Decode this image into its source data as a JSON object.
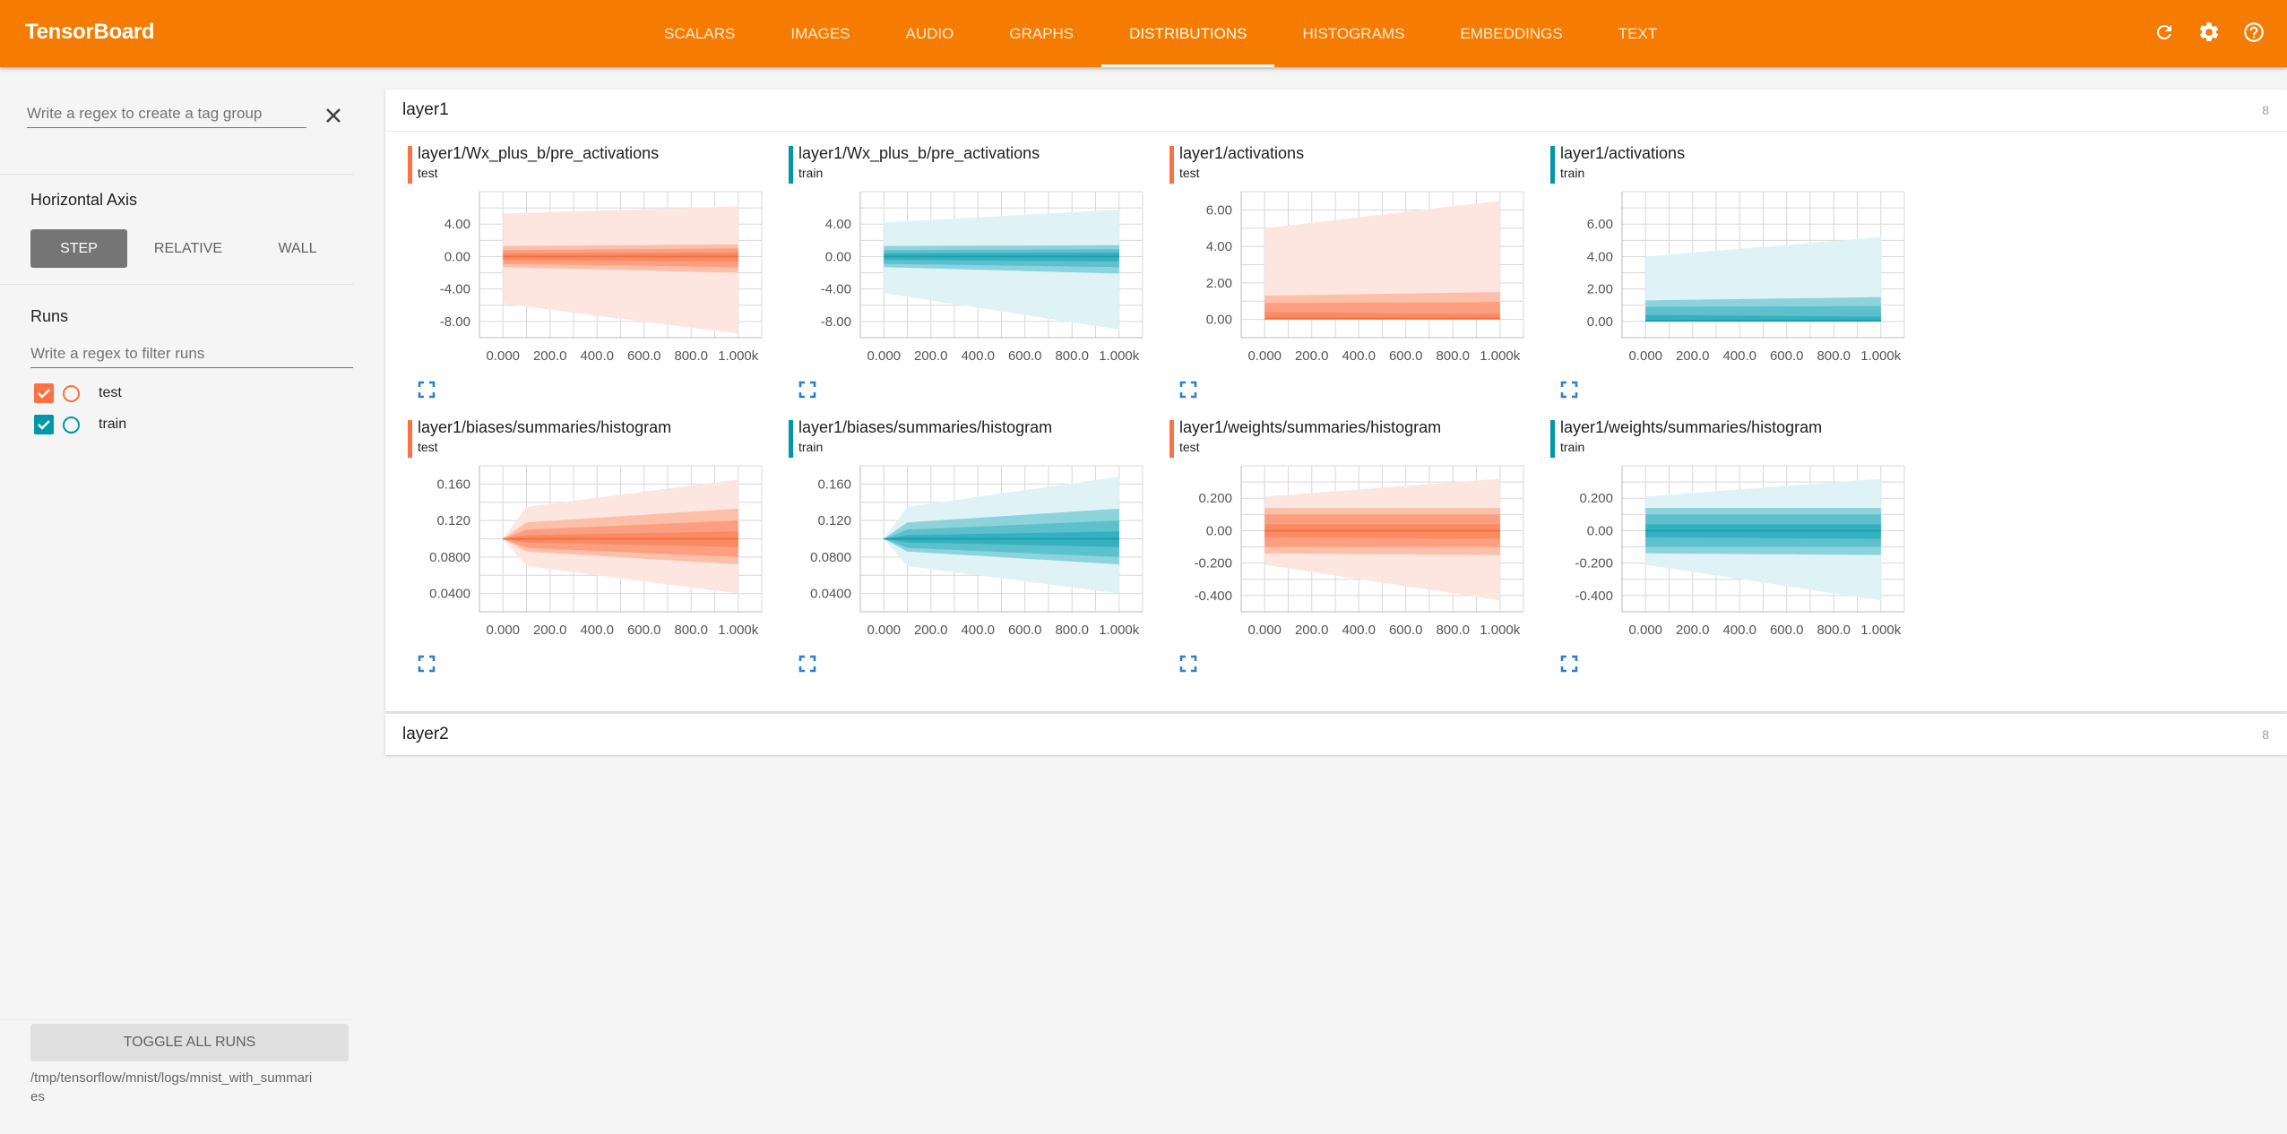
{
  "app": {
    "title": "TensorBoard",
    "tabs": [
      {
        "label": "SCALARS",
        "active": false
      },
      {
        "label": "IMAGES",
        "active": false
      },
      {
        "label": "AUDIO",
        "active": false
      },
      {
        "label": "GRAPHS",
        "active": false
      },
      {
        "label": "DISTRIBUTIONS",
        "active": true
      },
      {
        "label": "HISTOGRAMS",
        "active": false
      },
      {
        "label": "EMBEDDINGS",
        "active": false
      },
      {
        "label": "TEXT",
        "active": false
      }
    ],
    "icons": [
      "refresh-icon",
      "settings-gear-icon",
      "help-icon"
    ],
    "brand_color": "#f57c00"
  },
  "sidebar": {
    "tag_group_placeholder": "Write a regex to create a tag group",
    "tag_group_value": "",
    "horizontal_axis_title": "Horizontal Axis",
    "axis_options": [
      {
        "label": "STEP",
        "active": true
      },
      {
        "label": "RELATIVE",
        "active": false
      },
      {
        "label": "WALL",
        "active": false
      }
    ],
    "runs_title": "Runs",
    "runs_filter_placeholder": "Write a regex to filter runs",
    "runs_filter_value": "",
    "runs": [
      {
        "name": "test",
        "checked": true,
        "color": "#ff7043"
      },
      {
        "name": "train",
        "checked": true,
        "color": "#0097a7"
      }
    ],
    "toggle_all_label": "TOGGLE ALL RUNS",
    "logdir": "/tmp/tensorflow/mnist/logs/mnist_with_summaries"
  },
  "groups": [
    {
      "name": "layer1",
      "count": "8",
      "expanded": true
    },
    {
      "name": "layer2",
      "count": "8",
      "expanded": false
    }
  ],
  "chart_data": [
    {
      "type": "area",
      "title": "layer1/Wx_plus_b/pre_activations",
      "run": "test",
      "color": "#ff7043",
      "x_ticks": [
        "0.000",
        "200.0",
        "400.0",
        "600.0",
        "800.0",
        "1.000k"
      ],
      "xlim": [
        -100,
        1100
      ],
      "y_ticks": [
        "4.00",
        "0.00",
        "-4.00",
        "-8.00"
      ],
      "y_tick_values": [
        4,
        0,
        -4,
        -8
      ],
      "ylim": [
        -10,
        8
      ],
      "steps": [
        0,
        1000
      ],
      "bands": {
        "max": [
          5.3,
          6.2
        ],
        "p93": [
          1.3,
          1.5
        ],
        "p84": [
          0.8,
          1.0
        ],
        "p69": [
          0.4,
          0.5
        ],
        "p50": [
          0,
          0
        ],
        "p31": [
          -0.4,
          -0.6
        ],
        "p16": [
          -0.9,
          -1.3
        ],
        "p7": [
          -1.3,
          -2.0
        ],
        "min": [
          -5.8,
          -9.5
        ]
      }
    },
    {
      "type": "area",
      "title": "layer1/Wx_plus_b/pre_activations",
      "run": "train",
      "color": "#0097a7",
      "x_ticks": [
        "0.000",
        "200.0",
        "400.0",
        "600.0",
        "800.0",
        "1.000k"
      ],
      "xlim": [
        -100,
        1100
      ],
      "y_ticks": [
        "4.00",
        "0.00",
        "-4.00",
        "-8.00"
      ],
      "y_tick_values": [
        4,
        0,
        -4,
        -8
      ],
      "ylim": [
        -10,
        8
      ],
      "steps": [
        0,
        1000
      ],
      "bands": {
        "max": [
          4.2,
          5.8
        ],
        "p93": [
          1.3,
          1.4
        ],
        "p84": [
          0.8,
          0.9
        ],
        "p69": [
          0.4,
          0.5
        ],
        "p50": [
          0,
          0
        ],
        "p31": [
          -0.4,
          -0.6
        ],
        "p16": [
          -0.9,
          -1.3
        ],
        "p7": [
          -1.3,
          -2.1
        ],
        "min": [
          -4.5,
          -9.0
        ]
      }
    },
    {
      "type": "area",
      "title": "layer1/activations",
      "run": "test",
      "color": "#ff7043",
      "x_ticks": [
        "0.000",
        "200.0",
        "400.0",
        "600.0",
        "800.0",
        "1.000k"
      ],
      "xlim": [
        -100,
        1100
      ],
      "y_ticks": [
        "6.00",
        "4.00",
        "2.00",
        "0.00"
      ],
      "y_tick_values": [
        6,
        4,
        2,
        0
      ],
      "ylim": [
        -1,
        7
      ],
      "steps": [
        0,
        1000
      ],
      "bands": {
        "max": [
          5.0,
          6.5
        ],
        "p93": [
          1.3,
          1.5
        ],
        "p84": [
          0.9,
          0.95
        ],
        "p69": [
          0.4,
          0.3
        ],
        "p50": [
          0.05,
          0.05
        ],
        "p31": [
          0,
          0
        ],
        "p16": [
          0,
          0
        ],
        "p7": [
          0,
          0
        ],
        "min": [
          0,
          0
        ]
      }
    },
    {
      "type": "area",
      "title": "layer1/activations",
      "run": "train",
      "color": "#0097a7",
      "x_ticks": [
        "0.000",
        "200.0",
        "400.0",
        "600.0",
        "800.0",
        "1.000k"
      ],
      "xlim": [
        -100,
        1100
      ],
      "y_ticks": [
        "6.00",
        "4.00",
        "2.00",
        "0.00"
      ],
      "y_tick_values": [
        6,
        4,
        2,
        0
      ],
      "ylim": [
        -1,
        8
      ],
      "steps": [
        0,
        1000
      ],
      "bands": {
        "max": [
          4.0,
          5.2
        ],
        "p93": [
          1.3,
          1.5
        ],
        "p84": [
          0.9,
          0.95
        ],
        "p69": [
          0.4,
          0.3
        ],
        "p50": [
          0.05,
          0.05
        ],
        "p31": [
          0,
          0
        ],
        "p16": [
          0,
          0
        ],
        "p7": [
          0,
          0
        ],
        "min": [
          0,
          0
        ]
      }
    },
    {
      "type": "area",
      "title": "layer1/biases/summaries/histogram",
      "run": "test",
      "color": "#ff7043",
      "x_ticks": [
        "0.000",
        "200.0",
        "400.0",
        "600.0",
        "800.0",
        "1.000k"
      ],
      "xlim": [
        -100,
        1100
      ],
      "y_ticks": [
        "0.160",
        "0.120",
        "0.0800",
        "0.0400"
      ],
      "y_tick_values": [
        0.16,
        0.12,
        0.08,
        0.04
      ],
      "ylim": [
        0.02,
        0.18
      ],
      "steps": [
        0,
        100,
        1000
      ],
      "bands": {
        "max": [
          0.1,
          0.135,
          0.165
        ],
        "p93": [
          0.1,
          0.118,
          0.133
        ],
        "p84": [
          0.1,
          0.11,
          0.12
        ],
        "p69": [
          0.1,
          0.104,
          0.108
        ],
        "p50": [
          0.1,
          0.1,
          0.1
        ],
        "p31": [
          0.1,
          0.096,
          0.091
        ],
        "p16": [
          0.1,
          0.09,
          0.08
        ],
        "p7": [
          0.1,
          0.086,
          0.072
        ],
        "min": [
          0.1,
          0.07,
          0.04
        ]
      }
    },
    {
      "type": "area",
      "title": "layer1/biases/summaries/histogram",
      "run": "train",
      "color": "#0097a7",
      "x_ticks": [
        "0.000",
        "200.0",
        "400.0",
        "600.0",
        "800.0",
        "1.000k"
      ],
      "xlim": [
        -100,
        1100
      ],
      "y_ticks": [
        "0.160",
        "0.120",
        "0.0800",
        "0.0400"
      ],
      "y_tick_values": [
        0.16,
        0.12,
        0.08,
        0.04
      ],
      "ylim": [
        0.02,
        0.18
      ],
      "steps": [
        0,
        100,
        1000
      ],
      "bands": {
        "max": [
          0.1,
          0.135,
          0.168
        ],
        "p93": [
          0.1,
          0.118,
          0.133
        ],
        "p84": [
          0.1,
          0.11,
          0.12
        ],
        "p69": [
          0.1,
          0.104,
          0.108
        ],
        "p50": [
          0.1,
          0.1,
          0.1
        ],
        "p31": [
          0.1,
          0.096,
          0.091
        ],
        "p16": [
          0.1,
          0.09,
          0.08
        ],
        "p7": [
          0.1,
          0.086,
          0.072
        ],
        "min": [
          0.1,
          0.07,
          0.04
        ]
      }
    },
    {
      "type": "area",
      "title": "layer1/weights/summaries/histogram",
      "run": "test",
      "color": "#ff7043",
      "x_ticks": [
        "0.000",
        "200.0",
        "400.0",
        "600.0",
        "800.0",
        "1.000k"
      ],
      "xlim": [
        -100,
        1100
      ],
      "y_ticks": [
        "0.200",
        "0.00",
        "-0.200",
        "-0.400"
      ],
      "y_tick_values": [
        0.2,
        0,
        -0.2,
        -0.4
      ],
      "ylim": [
        -0.5,
        0.4
      ],
      "steps": [
        0,
        1000
      ],
      "bands": {
        "max": [
          0.21,
          0.32
        ],
        "p93": [
          0.14,
          0.14
        ],
        "p84": [
          0.1,
          0.1
        ],
        "p69": [
          0.04,
          0.04
        ],
        "p50": [
          0,
          0
        ],
        "p31": [
          -0.04,
          -0.05
        ],
        "p16": [
          -0.1,
          -0.1
        ],
        "p7": [
          -0.14,
          -0.15
        ],
        "min": [
          -0.21,
          -0.43
        ]
      }
    },
    {
      "type": "area",
      "title": "layer1/weights/summaries/histogram",
      "run": "train",
      "color": "#0097a7",
      "x_ticks": [
        "0.000",
        "200.0",
        "400.0",
        "600.0",
        "800.0",
        "1.000k"
      ],
      "xlim": [
        -100,
        1100
      ],
      "y_ticks": [
        "0.200",
        "0.00",
        "-0.200",
        "-0.400"
      ],
      "y_tick_values": [
        0.2,
        0,
        -0.2,
        -0.4
      ],
      "ylim": [
        -0.5,
        0.4
      ],
      "steps": [
        0,
        1000
      ],
      "bands": {
        "max": [
          0.21,
          0.32
        ],
        "p93": [
          0.14,
          0.14
        ],
        "p84": [
          0.1,
          0.1
        ],
        "p69": [
          0.04,
          0.04
        ],
        "p50": [
          0,
          0
        ],
        "p31": [
          -0.04,
          -0.05
        ],
        "p16": [
          -0.1,
          -0.1
        ],
        "p7": [
          -0.14,
          -0.15
        ],
        "min": [
          -0.21,
          -0.43
        ]
      }
    }
  ]
}
